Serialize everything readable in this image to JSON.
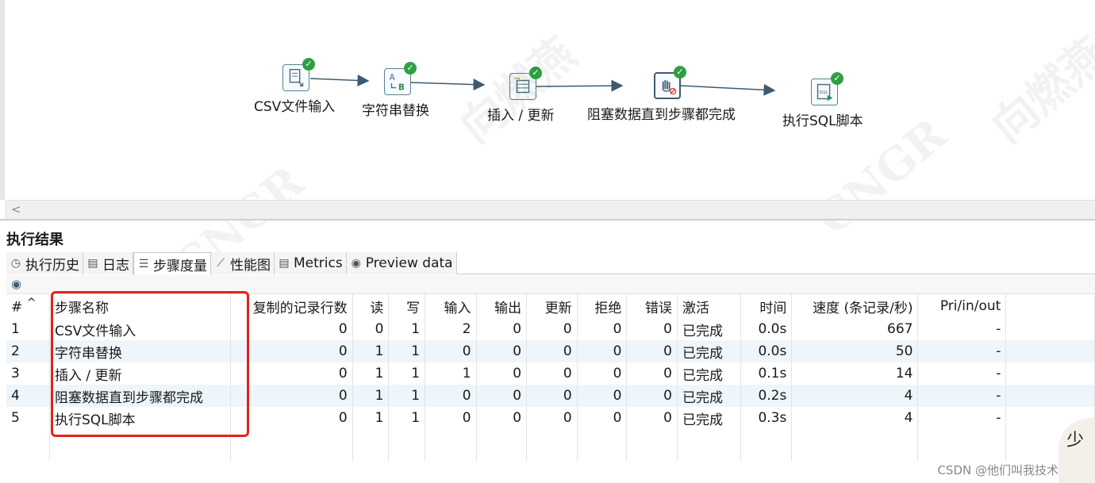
{
  "canvas": {
    "steps": [
      {
        "label": "CSV文件输入",
        "icon": "csv-input-icon"
      },
      {
        "label": "字符串替换",
        "icon": "string-replace-icon"
      },
      {
        "label": "插入 / 更新",
        "icon": "insert-update-icon"
      },
      {
        "label": "阻塞数据直到步骤都完成",
        "icon": "block-until-done-icon"
      },
      {
        "label": "执行SQL脚本",
        "icon": "sql-script-icon"
      }
    ],
    "status": "✓"
  },
  "scroll": {
    "left_arrow": "<"
  },
  "results": {
    "title": "执行结果",
    "tabs": [
      {
        "label": "执行历史",
        "icon": "clock-icon",
        "glyph": "◷"
      },
      {
        "label": "日志",
        "icon": "log-icon",
        "glyph": "▤"
      },
      {
        "label": "步骤度量",
        "icon": "metrics-list-icon",
        "glyph": "☰"
      },
      {
        "label": "性能图",
        "icon": "chart-icon",
        "glyph": "⟋"
      },
      {
        "label": "Metrics",
        "icon": "metrics-icon",
        "glyph": "▤"
      },
      {
        "label": "Preview data",
        "icon": "eye-icon",
        "glyph": "◉"
      }
    ],
    "active_tab": "步骤度量",
    "toolbar": {
      "eye_glyph": "◉"
    },
    "table": {
      "headers": [
        "#",
        "步骤名称",
        "复制的记录行数",
        "读",
        "写",
        "输入",
        "输出",
        "更新",
        "拒绝",
        "错误",
        "激活",
        "时间",
        "速度 (条记录/秒)",
        "Pri/in/out"
      ],
      "sort_indicator": "^",
      "rows": [
        [
          "1",
          "CSV文件输入",
          "0",
          "0",
          "1",
          "2",
          "0",
          "0",
          "0",
          "0",
          "已完成",
          "0.0s",
          "667",
          "-"
        ],
        [
          "2",
          "字符串替换",
          "0",
          "1",
          "1",
          "0",
          "0",
          "0",
          "0",
          "0",
          "已完成",
          "0.0s",
          "50",
          "-"
        ],
        [
          "3",
          "插入 / 更新",
          "0",
          "1",
          "1",
          "1",
          "0",
          "0",
          "0",
          "0",
          "已完成",
          "0.1s",
          "14",
          "-"
        ],
        [
          "4",
          "阻塞数据直到步骤都完成",
          "0",
          "1",
          "1",
          "0",
          "0",
          "0",
          "0",
          "0",
          "已完成",
          "0.2s",
          "4",
          "-"
        ],
        [
          "5",
          "执行SQL脚本",
          "0",
          "1",
          "1",
          "0",
          "0",
          "0",
          "0",
          "0",
          "已完成",
          "0.3s",
          "4",
          "-"
        ]
      ]
    }
  },
  "watermark": {
    "text": "CNGR",
    "text2": "向燃燕"
  },
  "credit": "CSDN @他们叫我技术总监",
  "stamp_char": "少",
  "colors": {
    "highlight": "#e2231a",
    "success": "#2ea043",
    "hop": "#3d5a73"
  }
}
